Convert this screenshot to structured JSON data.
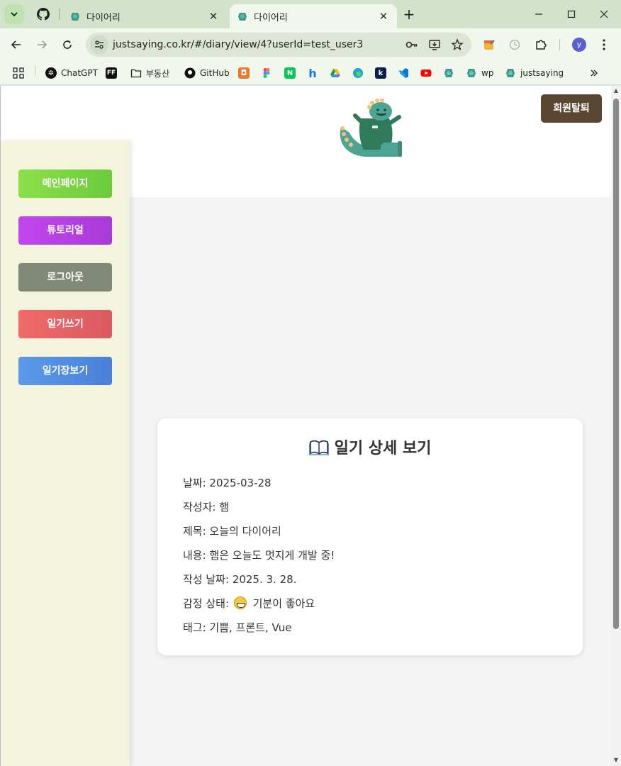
{
  "browser": {
    "tabs": [
      {
        "title": "다이어리",
        "active": false
      },
      {
        "title": "다이어리",
        "active": true
      }
    ],
    "url": "justsaying.co.kr/#/diary/view/4?userId=test_user3",
    "profile_initial": "y",
    "bookmarks": [
      {
        "label": "ChatGPT",
        "icon": "chatgpt-icon"
      },
      {
        "label": "",
        "icon": "ff-icon",
        "badge": "FF"
      },
      {
        "label": "부동산",
        "icon": "folder-icon"
      },
      {
        "label": "GitHub",
        "icon": "github-icon"
      },
      {
        "label": "",
        "icon": "orange-app-icon"
      },
      {
        "label": "",
        "icon": "figma-icon"
      },
      {
        "label": "",
        "icon": "naver-icon",
        "badge": "N"
      },
      {
        "label": "",
        "icon": "h-icon",
        "badge": "h"
      },
      {
        "label": "",
        "icon": "google-drive-icon"
      },
      {
        "label": "",
        "icon": "edge-icon"
      },
      {
        "label": "",
        "icon": "k-icon",
        "badge": "k"
      },
      {
        "label": "",
        "icon": "vscode-icon"
      },
      {
        "label": "",
        "icon": "youtube-icon"
      },
      {
        "label": "",
        "icon": "dino-icon"
      },
      {
        "label": "wp",
        "icon": "dino-icon"
      },
      {
        "label": "justsaying",
        "icon": "dino-icon"
      }
    ],
    "colors": {
      "tabstrip": "#d3e3cb",
      "toolbar": "#f2f7ee"
    }
  },
  "header": {
    "withdraw_label": "회원탈퇴"
  },
  "sidebar": {
    "items": [
      {
        "label": "메인페이지"
      },
      {
        "label": "튜토리얼"
      },
      {
        "label": "로그아웃"
      },
      {
        "label": "일기쓰기"
      },
      {
        "label": "일기장보기"
      }
    ]
  },
  "diary": {
    "heading": "일기 상세 보기",
    "date": "날짜: 2025-03-28",
    "author": "작성자: 햄",
    "title": "제목: 오늘의 다이어리",
    "content": "내용: 햄은 오늘도 멋지게 개발 중!",
    "written_date": "작성 날짜: 2025. 3. 28.",
    "emotion_prefix": "감정 상태:",
    "emotion_text": "기분이 좋아요",
    "tags": "태그: 기쁨, 프론트, Vue"
  }
}
